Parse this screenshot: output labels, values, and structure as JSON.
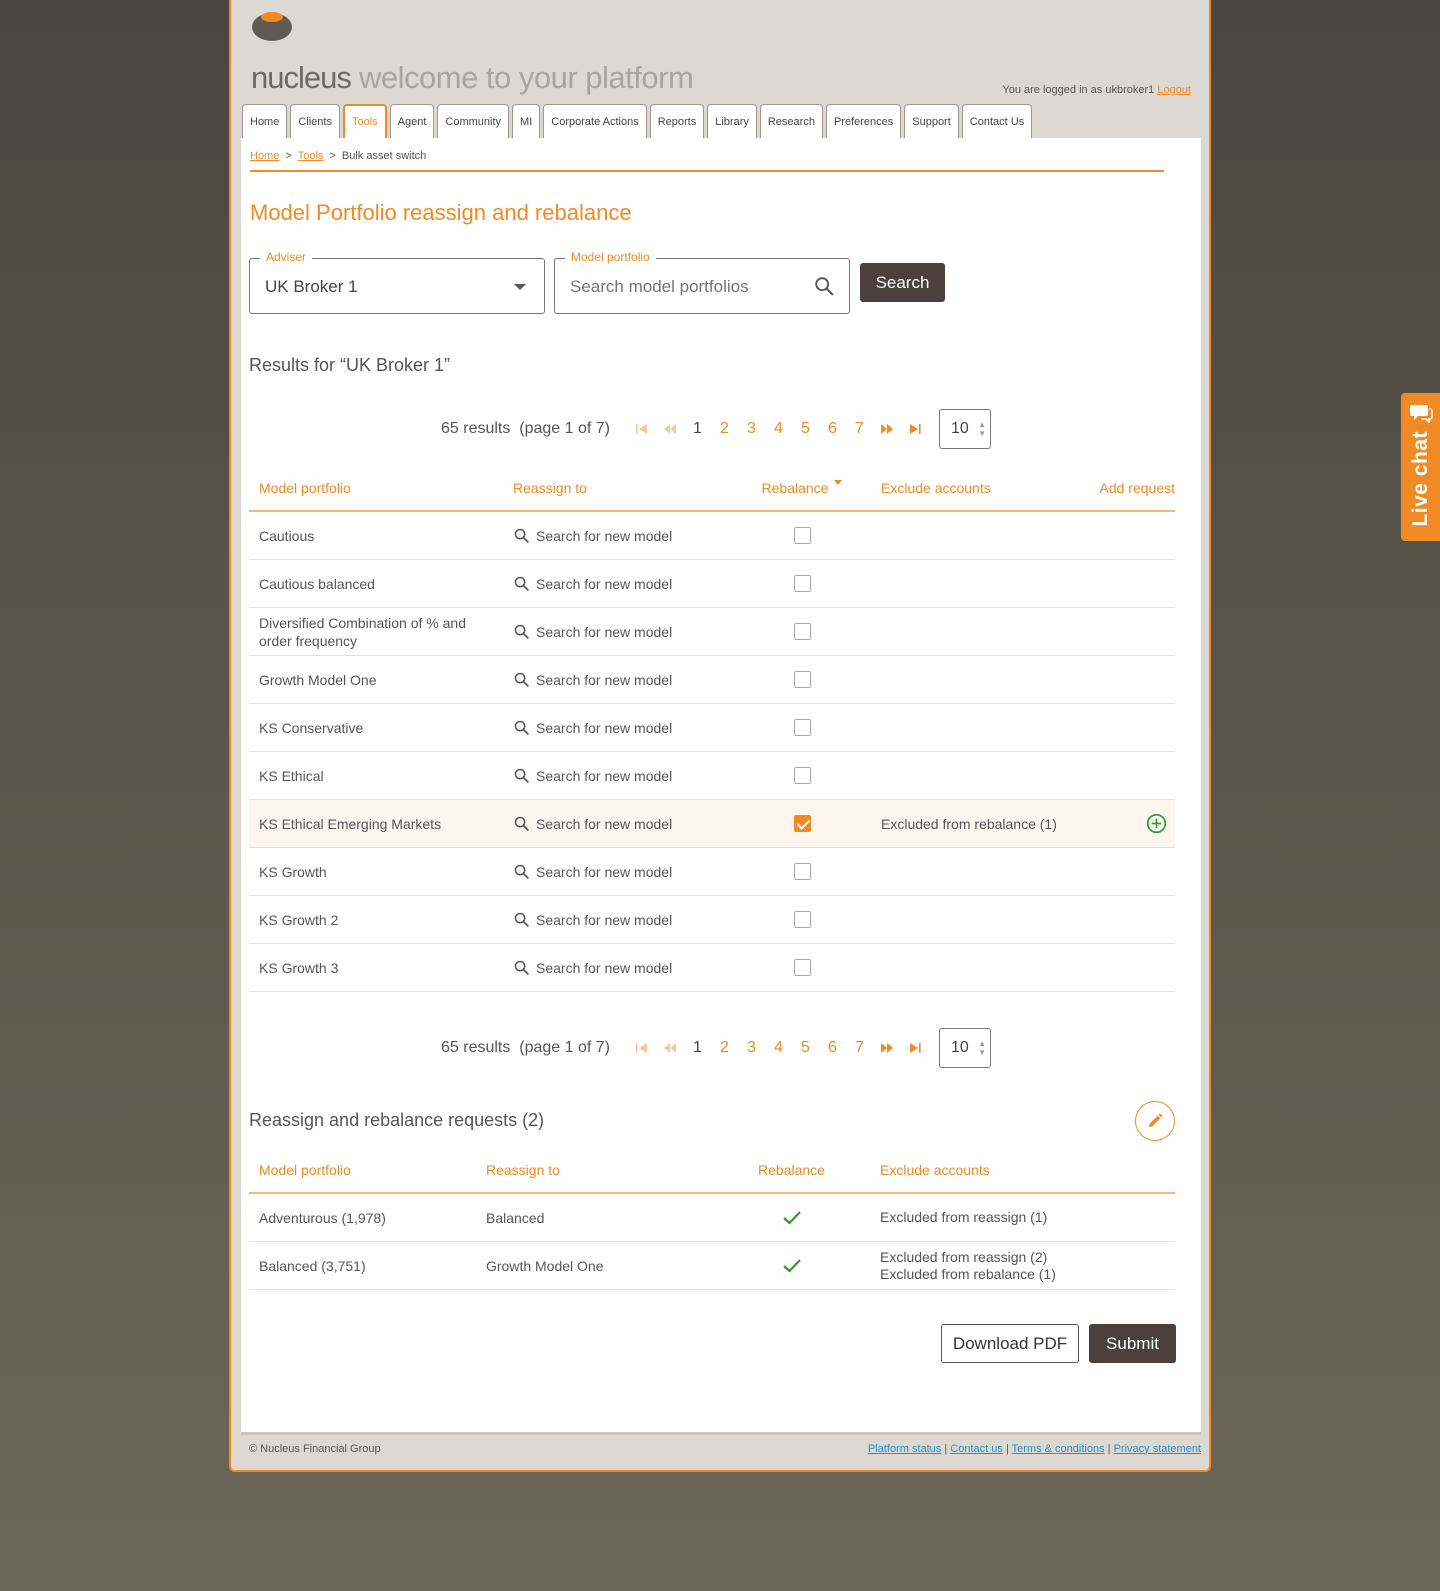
{
  "header": {
    "brand_name": "nucleus",
    "brand_tagline": "welcome to your platform",
    "logged_in_text": "You are logged in as ukbroker1",
    "logout_label": "Logout"
  },
  "nav": {
    "tabs": [
      {
        "label": "Home"
      },
      {
        "label": "Clients"
      },
      {
        "label": "Tools",
        "active": true
      },
      {
        "label": "Agent"
      },
      {
        "label": "Community"
      },
      {
        "label": "MI"
      },
      {
        "label": "Corporate Actions"
      },
      {
        "label": "Reports"
      },
      {
        "label": "Library"
      },
      {
        "label": "Research"
      },
      {
        "label": "Preferences"
      },
      {
        "label": "Support"
      },
      {
        "label": "Contact Us"
      }
    ]
  },
  "breadcrumb": {
    "home": "Home",
    "tools": "Tools",
    "current": "Bulk asset switch",
    "separator": ">"
  },
  "page_title": "Model Portfolio reassign and rebalance",
  "filters": {
    "adviser_label": "Adviser",
    "adviser_value": "UK Broker 1",
    "model_label": "Model portfolio",
    "model_placeholder": "Search model portfolios",
    "search_button": "Search"
  },
  "results_title": "Results for “UK Broker 1”",
  "pagination": {
    "count_text": "65 results",
    "page_text": "(page 1 of 7)",
    "pages": [
      "1",
      "2",
      "3",
      "4",
      "5",
      "6",
      "7"
    ],
    "current_page": "1",
    "per_page": "10"
  },
  "results_table": {
    "headers": {
      "model": "Model portfolio",
      "reassign": "Reassign to",
      "rebalance": "Rebalance",
      "exclude": "Exclude accounts",
      "add": "Add request"
    },
    "search_link_text": "Search for new model",
    "rows": [
      {
        "model": "Cautious",
        "rebalance": false,
        "exclude": ""
      },
      {
        "model": "Cautious balanced",
        "rebalance": false,
        "exclude": ""
      },
      {
        "model": "Diversified Combination of % and order frequency",
        "rebalance": false,
        "exclude": ""
      },
      {
        "model": "Growth Model One",
        "rebalance": false,
        "exclude": ""
      },
      {
        "model": "KS Conservative",
        "rebalance": false,
        "exclude": ""
      },
      {
        "model": "KS Ethical",
        "rebalance": false,
        "exclude": ""
      },
      {
        "model": "KS Ethical Emerging Markets",
        "rebalance": true,
        "exclude": "Excluded from rebalance (1)",
        "add": true
      },
      {
        "model": "KS Growth",
        "rebalance": false,
        "exclude": ""
      },
      {
        "model": "KS Growth 2",
        "rebalance": false,
        "exclude": ""
      },
      {
        "model": "KS Growth 3",
        "rebalance": false,
        "exclude": ""
      }
    ]
  },
  "requests": {
    "title": "Reassign and rebalance requests (2)",
    "headers": {
      "model": "Model portfolio",
      "reassign": "Reassign to",
      "rebalance": "Rebalance",
      "exclude": "Exclude accounts"
    },
    "rows": [
      {
        "model": "Adventurous (1,978)",
        "reassign": "Balanced",
        "rebalance": true,
        "exclude": [
          "Excluded from reassign (1)"
        ]
      },
      {
        "model": "Balanced (3,751)",
        "reassign": "Growth Model One",
        "rebalance": true,
        "exclude": [
          "Excluded from reassign (2)",
          "Excluded from rebalance (1)"
        ]
      }
    ],
    "download_button": "Download PDF",
    "submit_button": "Submit"
  },
  "footer": {
    "copyright": "© Nucleus Financial Group",
    "links": [
      "Platform status",
      "Contact us",
      "Terms & conditions",
      "Privacy statement"
    ],
    "separator": "|"
  },
  "live_chat": {
    "label": "Live chat"
  },
  "colors": {
    "accent": "#f08a24",
    "dark_button": "#4b403b",
    "link_blue": "#2a8fc9",
    "success_green": "#2e9b3a"
  },
  "icons": {
    "logo": "nucleus-logo-icon",
    "search": "search-icon",
    "dropdown": "chevron-down-icon",
    "add": "plus-circle-icon",
    "edit": "pencil-icon",
    "check": "check-icon",
    "chat": "chat-bubble-icon"
  }
}
